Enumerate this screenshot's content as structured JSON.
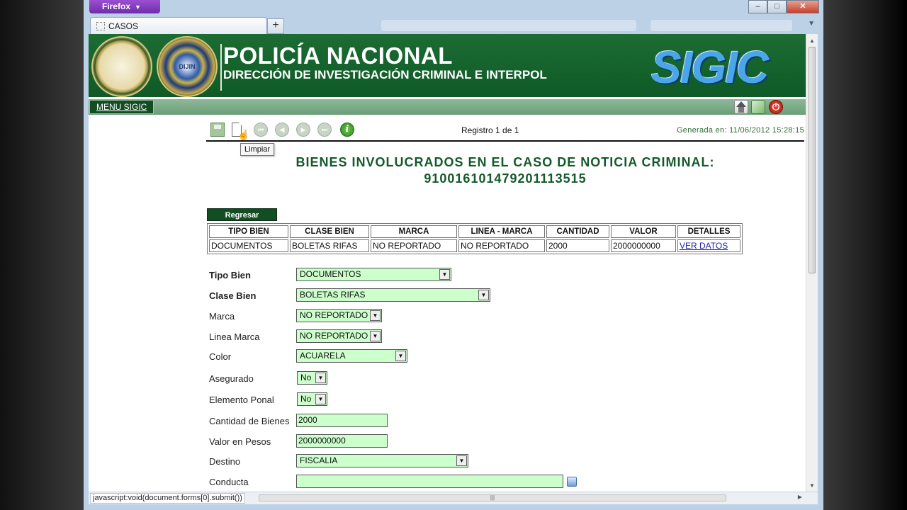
{
  "browser": {
    "app_button": "Firefox",
    "tab_title": "CASOS",
    "new_tab": "+",
    "window_buttons": {
      "minimize": "–",
      "maximize": "□",
      "close": "✕"
    },
    "status_url": "javascript:void(document.forms[0].submit())"
  },
  "header": {
    "title": "POLICÍA NACIONAL",
    "subtitle": "DIRECCIÓN DE INVESTIGACIÓN CRIMINAL E INTERPOL",
    "logo": "SIGIC",
    "seal2_text": "DIJIN"
  },
  "menu": {
    "link": "MENU SIGIC"
  },
  "toolbar": {
    "registro": "Registro 1 de 1",
    "generada": "Generada en: 11/06/2012 15:28:15",
    "tooltip": "Limpiar",
    "icons": [
      "save-icon",
      "new-icon",
      "first-icon",
      "prev-icon",
      "next-icon",
      "last-icon",
      "info-icon"
    ]
  },
  "page": {
    "heading_line1": "BIENES INVOLUCRADOS EN EL CASO DE NOTICIA CRIMINAL:",
    "heading_line2": "910016101479201113515",
    "regresar": "Regresar"
  },
  "table": {
    "headers": [
      "TIPO BIEN",
      "CLASE BIEN",
      "MARCA",
      "LINEA - MARCA",
      "CANTIDAD",
      "VALOR",
      "DETALLES"
    ],
    "row": [
      "DOCUMENTOS",
      "BOLETAS RIFAS",
      "NO REPORTADO",
      "NO REPORTADO",
      "2000",
      "2000000000",
      "VER DATOS"
    ]
  },
  "form": {
    "tipo_bien": {
      "label": "Tipo Bien",
      "value": "DOCUMENTOS"
    },
    "clase_bien": {
      "label": "Clase Bien",
      "value": "BOLETAS RIFAS"
    },
    "marca": {
      "label": "Marca",
      "value": "NO REPORTADO"
    },
    "linea_marca": {
      "label": "Linea Marca",
      "value": "NO REPORTADO"
    },
    "color": {
      "label": "Color",
      "value": "ACUARELA"
    },
    "asegurado": {
      "label": "Asegurado",
      "value": "No"
    },
    "elemento_ponal": {
      "label": "Elemento Ponal",
      "value": "No"
    },
    "cantidad": {
      "label": "Cantidad de Bienes",
      "value": "2000"
    },
    "valor": {
      "label": "Valor en Pesos",
      "value": "2000000000"
    },
    "destino": {
      "label": "Destino",
      "value": "FISCALIA"
    },
    "conducta": {
      "label": "Conducta",
      "value": ""
    }
  },
  "colors": {
    "banner_green": "#1c6c33",
    "field_bg": "#ccffcc",
    "heading_green": "#13592a",
    "firefox_purple": "#7b37b8"
  }
}
